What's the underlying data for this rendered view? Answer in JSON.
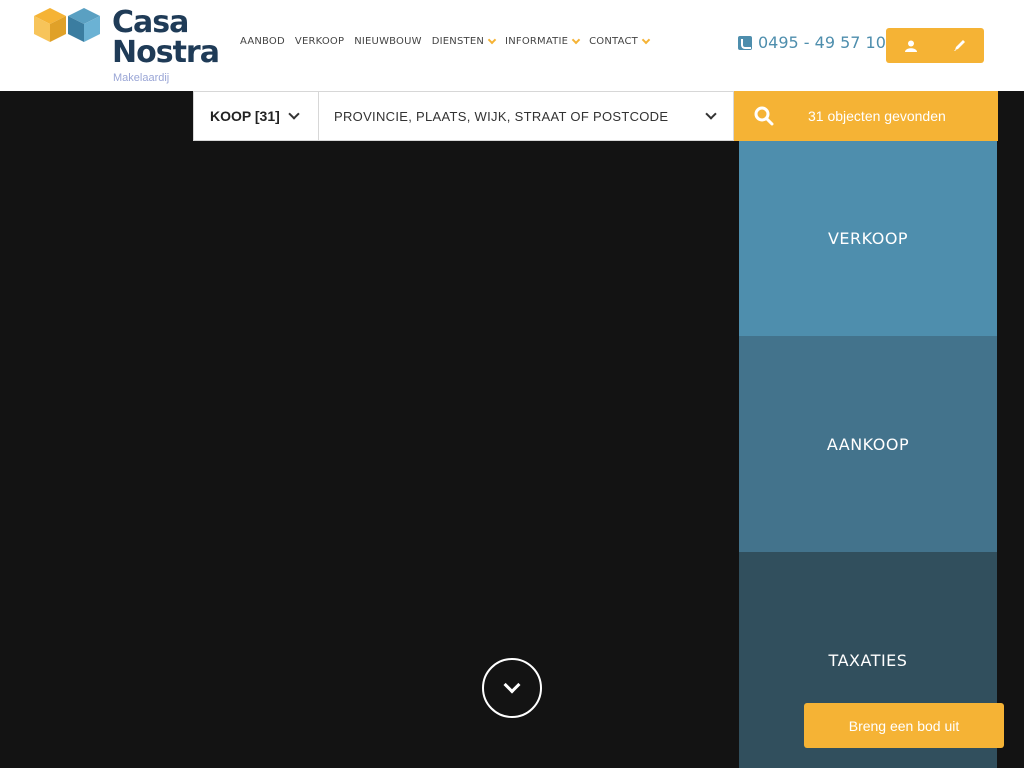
{
  "header": {
    "logo": {
      "line1": "Casa",
      "line2": "Nostra",
      "subtitle": "Makelaardij"
    },
    "nav": [
      {
        "label": "AANBOD",
        "dropdown": false
      },
      {
        "label": "VERKOOP",
        "dropdown": false
      },
      {
        "label": "NIEUWBOUW",
        "dropdown": false
      },
      {
        "label": "DIENSTEN",
        "dropdown": true
      },
      {
        "label": "INFORMATIE",
        "dropdown": true
      },
      {
        "label": "CONTACT",
        "dropdown": true
      }
    ],
    "phone": "0495 - 49 57 10",
    "buttons": {
      "left_icon": "user-icon",
      "right_icon": "pencil-icon"
    }
  },
  "search": {
    "type_label": "KOOP [31]",
    "location_placeholder": "PROVINCIE, PLAATS, WIJK, STRAAT OF POSTCODE",
    "results_label": "31 objecten gevonden",
    "search_icon": "search-icon"
  },
  "panels": [
    {
      "label": "VERKOOP"
    },
    {
      "label": "AANKOOP"
    },
    {
      "label": "TAXATIES"
    }
  ],
  "cta_label": "Breng een bod uit",
  "colors": {
    "accent": "#f5b335",
    "blue": "#4e8ead",
    "blue_mid": "#43738c",
    "blue_dark": "#314f5d",
    "hero_bg": "#131313"
  }
}
